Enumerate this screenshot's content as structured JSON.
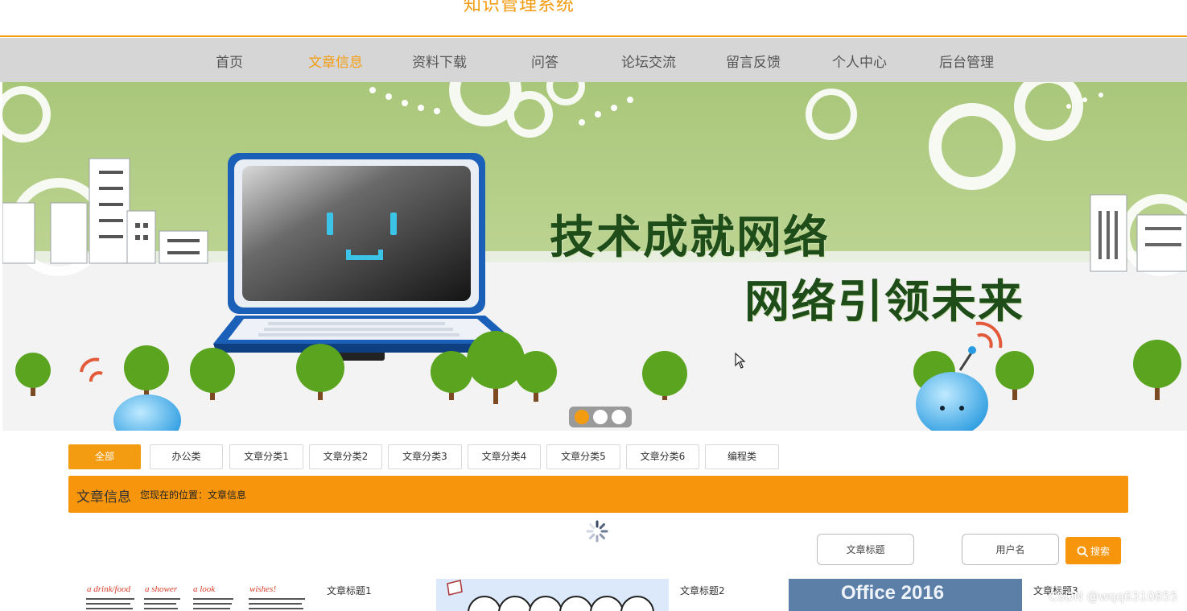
{
  "header": {
    "site_title": "知识管理系统"
  },
  "nav": {
    "items": [
      {
        "label": "首页"
      },
      {
        "label": "文章信息",
        "active": true
      },
      {
        "label": "资料下载"
      },
      {
        "label": "问答"
      },
      {
        "label": "论坛交流"
      },
      {
        "label": "留言反馈"
      },
      {
        "label": "个人中心"
      },
      {
        "label": "后台管理"
      }
    ]
  },
  "banner": {
    "line1": "技术成就网络",
    "line2": "网络引领未来",
    "slides": 3,
    "active_slide": 1
  },
  "categories": [
    {
      "label": "全部",
      "active": true
    },
    {
      "label": "办公类"
    },
    {
      "label": "文章分类1"
    },
    {
      "label": "文章分类2"
    },
    {
      "label": "文章分类3"
    },
    {
      "label": "文章分类4"
    },
    {
      "label": "文章分类5"
    },
    {
      "label": "文章分类6"
    },
    {
      "label": "编程类"
    }
  ],
  "section": {
    "title": "文章信息",
    "breadcrumb": "您现在的位置：文章信息"
  },
  "search": {
    "title_placeholder": "文章标题",
    "user_placeholder": "用户名",
    "button_label": "搜索",
    "button_icon": "search-icon"
  },
  "articles": [
    {
      "title": "文章标题1"
    },
    {
      "title": "文章标题2"
    },
    {
      "title": "文章标题3",
      "thumb_text": "Office 2016"
    }
  ],
  "thumb1_text": {
    "a": "a drink/food",
    "b": "a shower",
    "c": "a look",
    "d": "wishes!"
  },
  "watermark": "CSDN @wqq6310855",
  "colors": {
    "accent": "#f39c12",
    "nav_bg": "#d6d6d6",
    "section_bg": "#f7960d"
  }
}
